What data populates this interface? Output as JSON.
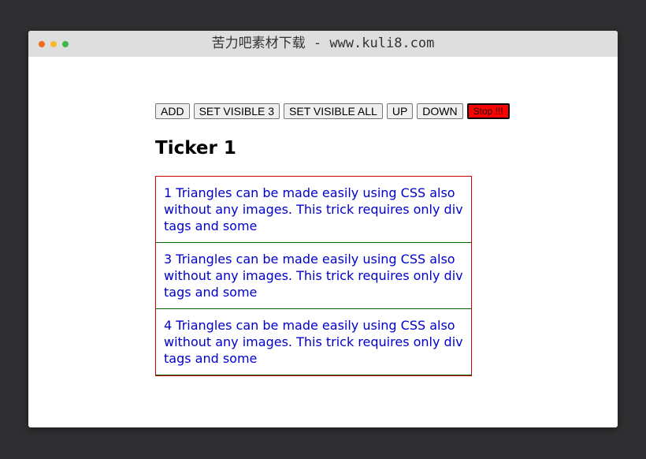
{
  "window": {
    "title": "苦力吧素材下载 - www.kuli8.com"
  },
  "toolbar": {
    "buttons": [
      {
        "label": "ADD"
      },
      {
        "label": "SET VISIBLE 3"
      },
      {
        "label": "SET VISIBLE ALL"
      },
      {
        "label": "UP"
      },
      {
        "label": "DOWN"
      },
      {
        "label": "Stop !!!"
      }
    ]
  },
  "ticker": {
    "heading": "Ticker 1",
    "items": [
      {
        "text": "1 Triangles can be made easily using CSS also without any images. This trick requires only div tags and some"
      },
      {
        "text": "3 Triangles can be made easily using CSS also without any images. This trick requires only div tags and some"
      },
      {
        "text": "4 Triangles can be made easily using CSS also without any images. This trick requires only div tags and some"
      }
    ]
  },
  "colors": {
    "stop_button": "#ff0000",
    "ticker_border": "#cc0000",
    "item_divider": "#006600",
    "item_text": "#0000cc"
  }
}
